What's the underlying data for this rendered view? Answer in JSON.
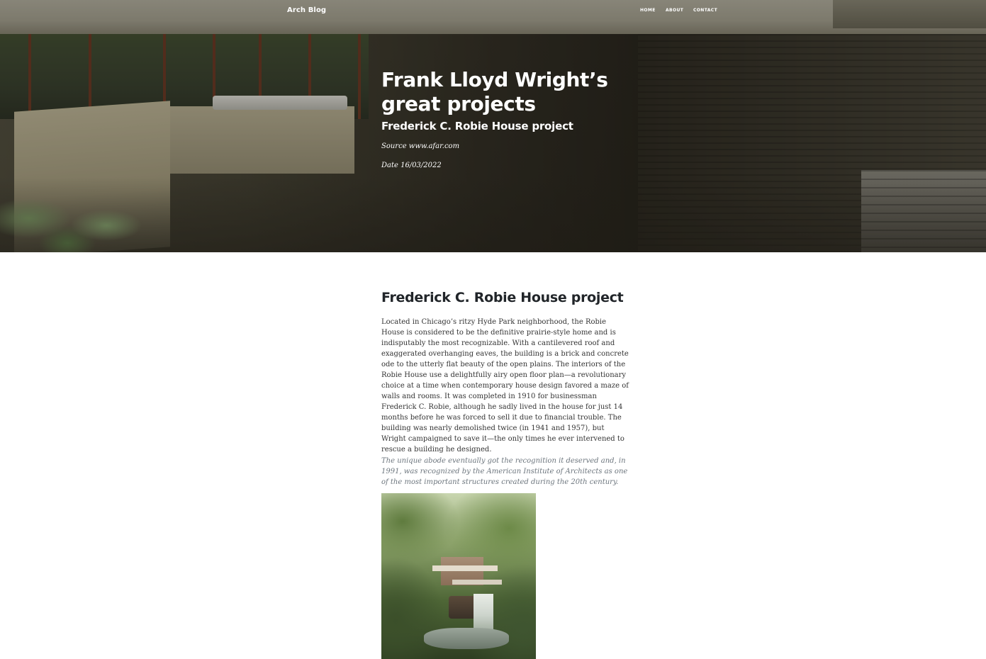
{
  "nav": {
    "brand": "Arch Blog",
    "items": [
      {
        "label": "HOME"
      },
      {
        "label": "ABOUT"
      },
      {
        "label": "CONTACT"
      }
    ]
  },
  "hero": {
    "title": "Frank Lloyd Wright’s great projects",
    "subtitle": "Frederick C. Robie House project",
    "source": "Source www.afar.com",
    "date": "Date 16/03/2022"
  },
  "article": {
    "heading": "Frederick C. Robie House project",
    "body": "Located in Chicago’s ritzy Hyde Park neighborhood, the Robie House is considered to be the definitive prairie-style home and is indisputably the most recognizable. With a cantilevered roof and exaggerated overhanging eaves, the building is a brick and concrete ode to the utterly flat beauty of the open plains. The interiors of the Robie House use a delightfully airy open floor plan—a revolutionary choice at a time when contemporary house design favored a maze of walls and rooms. It was completed in 1910 for businessman Frederick C. Robie, although he sadly lived in the house for just 14 months before he was forced to sell it due to financial trouble. The building was nearly demolished twice (in 1941 and 1957), but Wright campaigned to save it—the only times he ever intervened to rescue a building he designed.",
    "quote": "The unique abode eventually got the recognition it deserved and, in 1991, was recognized by the American Institute of Architects as one of the most important structures created during the 20th century."
  }
}
